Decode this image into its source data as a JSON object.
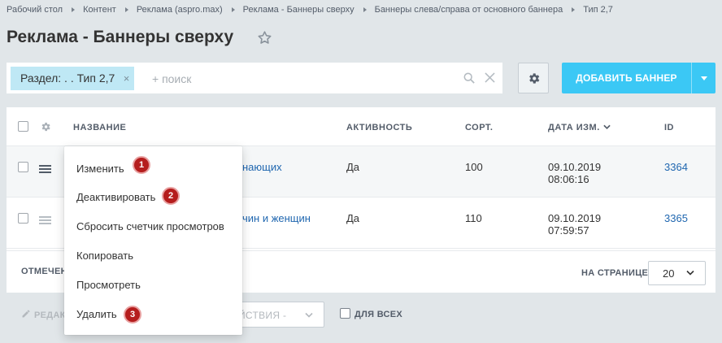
{
  "breadcrumb": [
    "Рабочий стол",
    "Контент",
    "Реклама (aspro.max)",
    "Реклама - Баннеры сверху",
    "Баннеры слева/справа от основного баннера",
    "Тип 2,7"
  ],
  "page_title": "Реклама - Баннеры сверху",
  "filter": {
    "chip_label": "Раздел: . . Тип 2,7",
    "chip_close": "×",
    "search_placeholder": "+ поиск"
  },
  "toolbar": {
    "add_label": "ДОБАВИТЬ БАННЕР"
  },
  "grid": {
    "headers": {
      "name": "НАЗВАНИЕ",
      "active": "АКТИВНОСТЬ",
      "sort": "СОРТ.",
      "date": "ДАТА ИЗМ.",
      "id": "ID"
    },
    "rows": [
      {
        "name_partial": "нающих",
        "active": "Да",
        "sort": "100",
        "date": "09.10.2019",
        "time": "08:06:16",
        "id": "3364"
      },
      {
        "name_partial": "чин и женщин",
        "active": "Да",
        "sort": "110",
        "date": "09.10.2019",
        "time": "07:59:57",
        "id": "3365"
      }
    ]
  },
  "footer": {
    "selected_label": "ОТМЕЧЕН",
    "per_page_label": "НА СТРАНИЦЕ:",
    "per_page_value": "20"
  },
  "actions": {
    "edit_label": "РЕДАК",
    "select_label": "ЙСТВИЯ -",
    "all_label": "ДЛЯ ВСЕХ"
  },
  "context_menu": {
    "items": [
      "Изменить",
      "Деактивировать",
      "Сбросить счетчик просмотров",
      "Копировать",
      "Просмотреть",
      "Удалить"
    ],
    "badges": [
      "1",
      "2",
      "3"
    ]
  },
  "colors": {
    "accent": "#3bc8f5",
    "chip": "#bfe8f5",
    "link": "#2067b0",
    "badge": "#b51d1d",
    "background": "#e1e6e9"
  }
}
